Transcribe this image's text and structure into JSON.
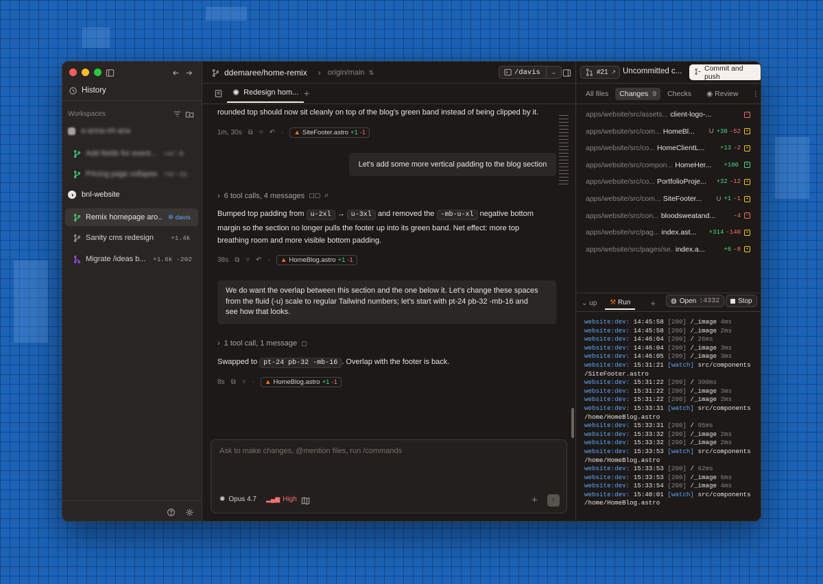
{
  "sidebar": {
    "history_label": "History",
    "workspaces_label": "Workspaces",
    "groups": [
      {
        "name": "a-anna-nh-ana",
        "items": [
          {
            "label": "Add fields for event...",
            "stat": "+4/-8"
          },
          {
            "label": "Pricing page collapse",
            "stat": "+3/-21"
          }
        ]
      },
      {
        "name": "bnl-website",
        "items": [
          {
            "label": "Remix homepage aro...",
            "badge": "davis"
          },
          {
            "label": "Sanity cms redesign",
            "stat": "+1.4k"
          },
          {
            "label": "Migrate /ideas b...",
            "stat": "+1.6k -202"
          }
        ]
      }
    ]
  },
  "header": {
    "branch": "ddemaree/home-remix",
    "target": "origin/main",
    "workspace_path": "/davis",
    "pr": "#21",
    "status": "Uncommitted c...",
    "commit_label": "Commit and push"
  },
  "tabs": {
    "active": "Redesign hom..."
  },
  "chat": {
    "msg1_tail": "rounded top should now sit cleanly on top of the blog's green band instead of being clipped by it.",
    "msg1_meta": {
      "time": "1m, 30s",
      "file": "SiteFooter.astro",
      "add": "+1",
      "del": "-1"
    },
    "user1": "Let's add some more vertical padding to the blog section",
    "toolcalls1": "6 tool calls, 4 messages",
    "msg2": {
      "p1": "Bumped top padding from",
      "c1": "u-2xl",
      "p2": "→",
      "c2": "u-3xl",
      "p3": "and removed the",
      "c3": "-mb-u-xl",
      "p4": "negative bottom",
      "line2": "margin so the section no longer pulls the footer up into its green band. Net effect: more top",
      "line3": "breathing room and more visible bottom padding."
    },
    "msg2_meta": {
      "time": "38s",
      "file": "HomeBlog.astro",
      "add": "+1",
      "del": "-1"
    },
    "user2": {
      "line1": "We do want the overlap between this section and the one below it. Let's change these spaces",
      "line2": "from the fluid (-u) scale to regular Tailwind numbers; let's start with pt-24 pb-32 -mb-16 and",
      "line3": "see how that looks."
    },
    "toolcalls2": "1 tool call, 1 message",
    "msg3": {
      "p1": "Swapped to",
      "c1": "pt-24 pb-32 -mb-16",
      "p2": ". Overlap with the footer is back."
    },
    "msg3_meta": {
      "time": "8s",
      "file": "HomeBlog.astro",
      "add": "+1",
      "del": "-1"
    }
  },
  "composer": {
    "placeholder": "Ask to make changes, @mention files, run /commands",
    "model": "Opus 4.7",
    "effort": "High"
  },
  "right": {
    "tabs": {
      "all": "All files",
      "changes": "Changes",
      "changes_count": "9",
      "checks": "Checks",
      "review": "Review"
    },
    "files": [
      {
        "path": "apps/website/src/assets...",
        "name": "client-logo-...",
        "status": "",
        "add": "",
        "del": "",
        "mark": "del"
      },
      {
        "path": "apps/website/src/com...",
        "name": "HomeBl...",
        "status": "U",
        "add": "+38",
        "del": "-52",
        "mark": "mod"
      },
      {
        "path": "apps/website/src/co...",
        "name": "HomeClientL...",
        "status": "",
        "add": "+13",
        "del": "-2",
        "mark": "mod"
      },
      {
        "path": "apps/website/src/compon...",
        "name": "HomeHer...",
        "status": "",
        "add": "+100",
        "del": "",
        "mark": "add"
      },
      {
        "path": "apps/website/src/co...",
        "name": "PortfolioProje...",
        "status": "",
        "add": "+32",
        "del": "-12",
        "mark": "mod"
      },
      {
        "path": "apps/website/src/com...",
        "name": "SiteFooter...",
        "status": "U",
        "add": "+1",
        "del": "-1",
        "mark": "mod"
      },
      {
        "path": "apps/website/src/con...",
        "name": "bloodsweatand...",
        "status": "",
        "add": "",
        "del": "-4",
        "mark": "del"
      },
      {
        "path": "apps/website/src/pag...",
        "name": "index.ast...",
        "status": "",
        "add": "+314",
        "del": "-140",
        "mark": "mod"
      },
      {
        "path": "apps/website/src/pages/se...",
        "name": "index.a...",
        "status": "",
        "add": "+6",
        "del": "-8",
        "mark": "mod"
      }
    ],
    "terminal": {
      "tab_up": "up",
      "tab_run": "Run",
      "open_label": "Open",
      "port": ":4332",
      "stop_label": "Stop",
      "lines": [
        [
          "website:dev:",
          "14:45:58",
          "[200]",
          "/_image",
          "4ms"
        ],
        [
          "website:dev:",
          "14:45:58",
          "[200]",
          "/_image",
          "2ms"
        ],
        [
          "website:dev:",
          "14:46:04",
          "[200]",
          "/",
          "26ms"
        ],
        [
          "website:dev:",
          "14:46:04",
          "[200]",
          "/_image",
          "3ms"
        ],
        [
          "website:dev:",
          "14:46:05",
          "[200]",
          "/_image",
          "3ms"
        ],
        [
          "website:dev:",
          "15:31:21",
          "[watch]",
          "src/components",
          ""
        ],
        [
          "",
          "",
          "",
          "/SiteFooter.astro",
          ""
        ],
        [
          "website:dev:",
          "15:31:22",
          "[200]",
          "/",
          "300ms"
        ],
        [
          "website:dev:",
          "15:31:22",
          "[200]",
          "/_image",
          "3ms"
        ],
        [
          "website:dev:",
          "15:31:22",
          "[200]",
          "/_image",
          "2ms"
        ],
        [
          "website:dev:",
          "15:33:31",
          "[watch]",
          "src/components",
          ""
        ],
        [
          "",
          "",
          "",
          "/home/HomeBlog.astro",
          ""
        ],
        [
          "website:dev:",
          "15:33:31",
          "[200]",
          "/",
          "95ms"
        ],
        [
          "website:dev:",
          "15:33:32",
          "[200]",
          "/_image",
          "2ms"
        ],
        [
          "website:dev:",
          "15:33:32",
          "[200]",
          "/_image",
          "2ms"
        ],
        [
          "website:dev:",
          "15:33:53",
          "[watch]",
          "src/components",
          ""
        ],
        [
          "",
          "",
          "",
          "/home/HomeBlog.astro",
          ""
        ],
        [
          "website:dev:",
          "15:33:53",
          "[200]",
          "/",
          "62ms"
        ],
        [
          "website:dev:",
          "15:33:53",
          "[200]",
          "/_image",
          "6ms"
        ],
        [
          "website:dev:",
          "15:33:54",
          "[200]",
          "/_image",
          "4ms"
        ],
        [
          "website:dev:",
          "15:40:01",
          "[watch]",
          "src/components",
          ""
        ],
        [
          "",
          "",
          "",
          "/home/HomeBlog.astro",
          ""
        ]
      ]
    }
  },
  "colors": {
    "accent_orange": "#f97316",
    "accent_blue": "#60a5fa",
    "green": "#4ade80",
    "red": "#f87171",
    "commit_btn_bg": "#f5f0eb"
  }
}
